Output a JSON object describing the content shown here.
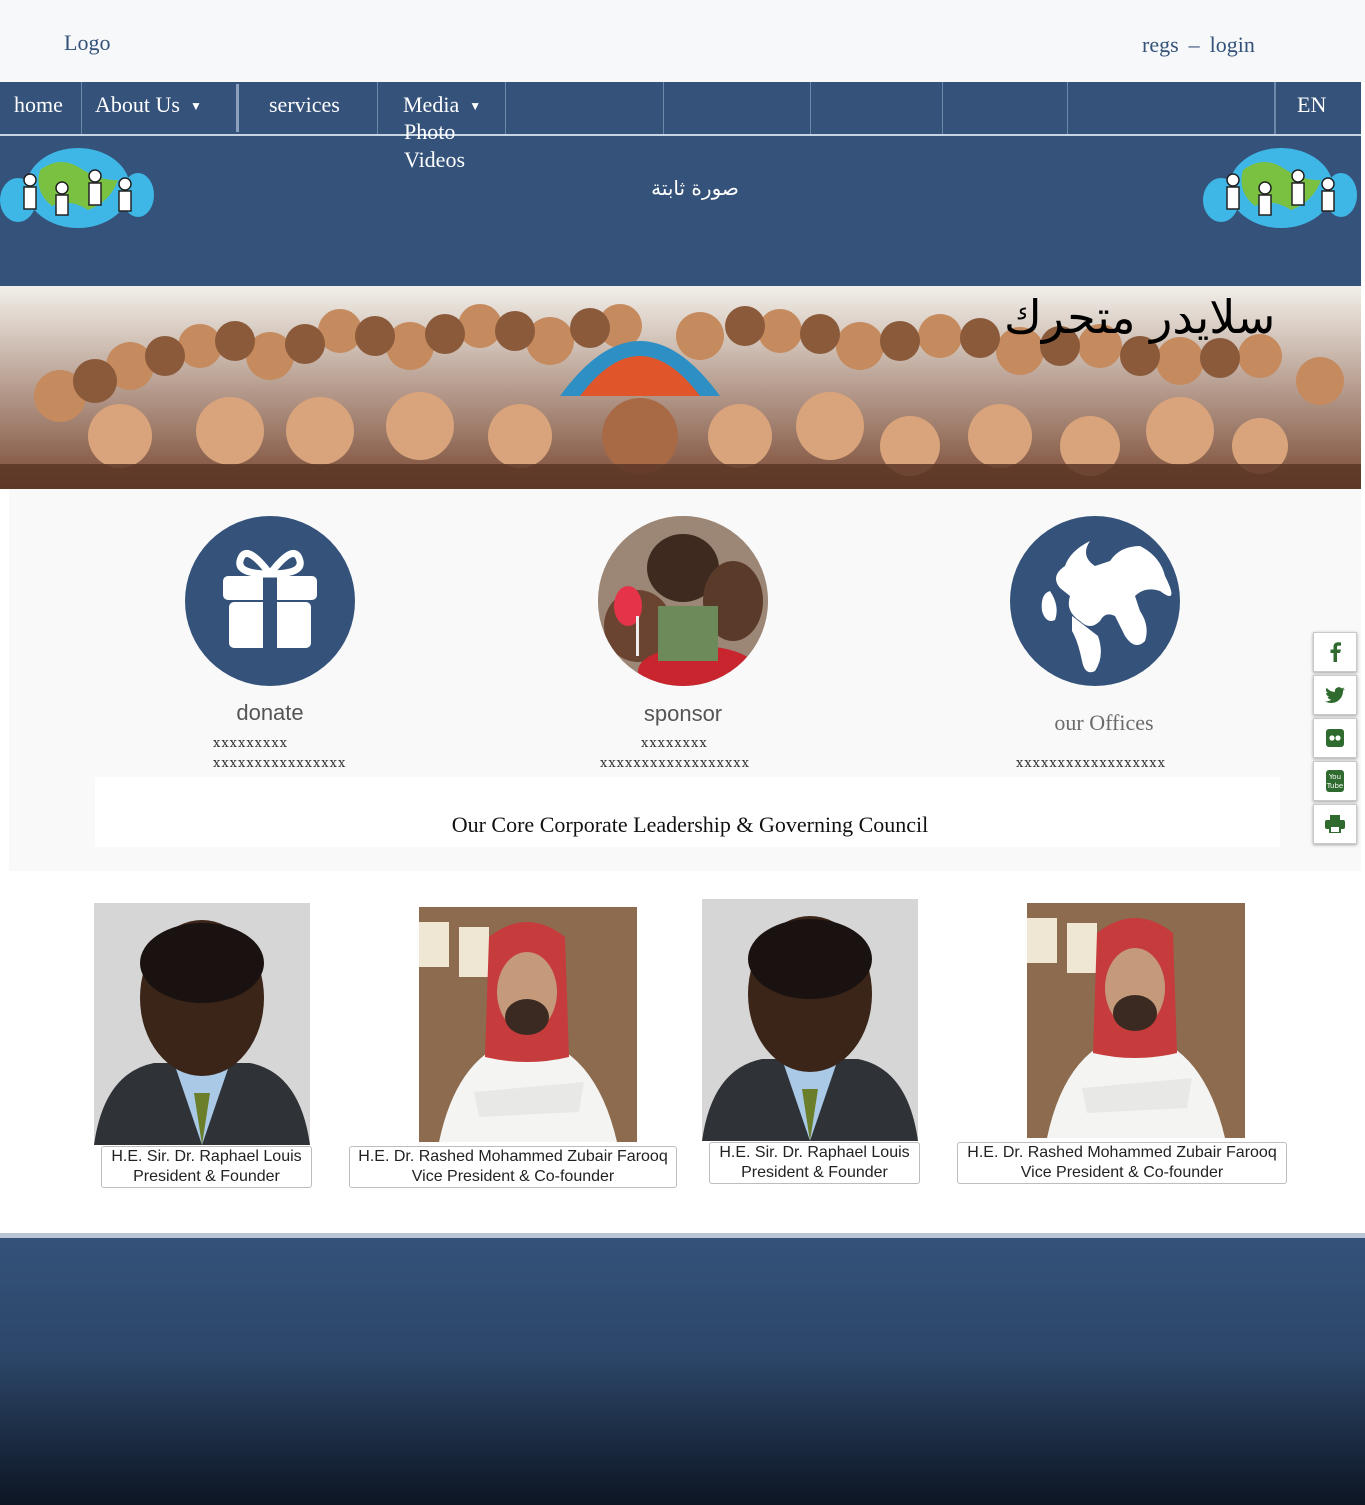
{
  "header": {
    "logo": "Logo",
    "register": "regs",
    "separator": "–",
    "login": "login"
  },
  "nav": {
    "items": [
      {
        "label": "home"
      },
      {
        "label": "About Us"
      },
      {
        "label": "services"
      },
      {
        "label": "Media"
      }
    ],
    "language": "EN",
    "media_submenu": [
      "Photo",
      "Videos"
    ]
  },
  "hero": {
    "static_image_label": "صورة ثابتة"
  },
  "slider": {
    "title": "سلايدر متحرك"
  },
  "services": [
    {
      "title": "donate",
      "line1": "xxxxxxxxx",
      "line2": "xxxxxxxxxxxxxxxx",
      "icon": "gift-icon"
    },
    {
      "title": "sponsor",
      "line1": "xxxxxxxx",
      "line2": "xxxxxxxxxxxxxxxxxx",
      "icon": "children-photo"
    },
    {
      "title": "our Offices",
      "line1": "xxxxxxxxxxxxxxxxxx",
      "icon": "globe-icon"
    }
  ],
  "council": {
    "title": "Our Core Corporate Leadership & Governing Council"
  },
  "leaders": [
    {
      "name": "H.E. Sir. Dr. Raphael Louis",
      "role": "President & Founder"
    },
    {
      "name": "H.E. Dr. Rashed Mohammed Zubair Farooq",
      "role": "Vice President & Co-founder"
    },
    {
      "name": "H.E. Sir. Dr. Raphael Louis",
      "role": "President & Founder"
    },
    {
      "name": "H.E. Dr. Rashed Mohammed Zubair Farooq",
      "role": "Vice President & Co-founder"
    }
  ],
  "social": [
    "facebook-icon",
    "twitter-icon",
    "flickr-icon",
    "youtube-icon",
    "print-icon"
  ],
  "colors": {
    "brand": "#34527a",
    "panel": "#f9f9f9",
    "footer_dark": "#0d1523"
  }
}
